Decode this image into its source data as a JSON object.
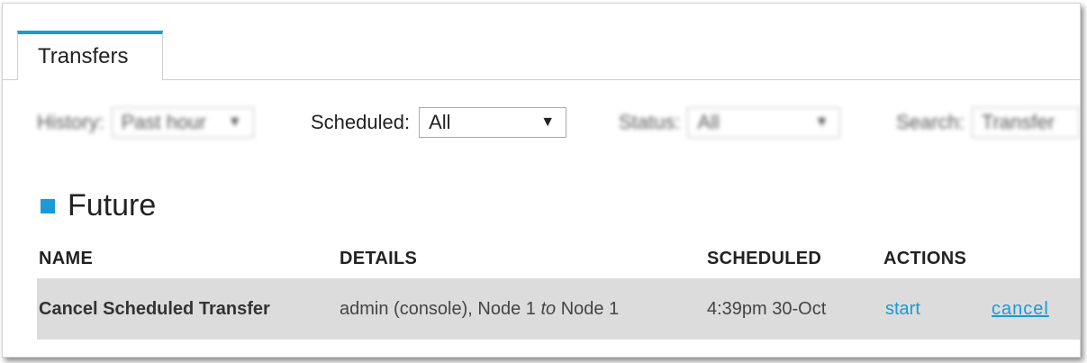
{
  "tabs": [
    {
      "label": "Transfers",
      "active": true
    }
  ],
  "filters": {
    "history": {
      "label": "History:",
      "value": "Past hour"
    },
    "scheduled": {
      "label": "Scheduled:",
      "value": "All"
    },
    "status": {
      "label": "Status:",
      "value": "All"
    },
    "search": {
      "label": "Search:",
      "value": "Transfer"
    }
  },
  "section": {
    "title": "Future",
    "marker_color": "#1a9ad6"
  },
  "table": {
    "columns": [
      "NAME",
      "DETAILS",
      "SCHEDULED",
      "ACTIONS"
    ],
    "rows": [
      {
        "name": "Cancel Scheduled Transfer",
        "details_pre": "admin (console), Node 1 ",
        "details_em": "to",
        "details_post": " Node 1",
        "scheduled": "4:39pm 30-Oct",
        "action_start": "start",
        "action_cancel": "cancel"
      }
    ]
  },
  "colors": {
    "accent": "#1a9ad6",
    "row_bg": "#dcdcdc"
  }
}
